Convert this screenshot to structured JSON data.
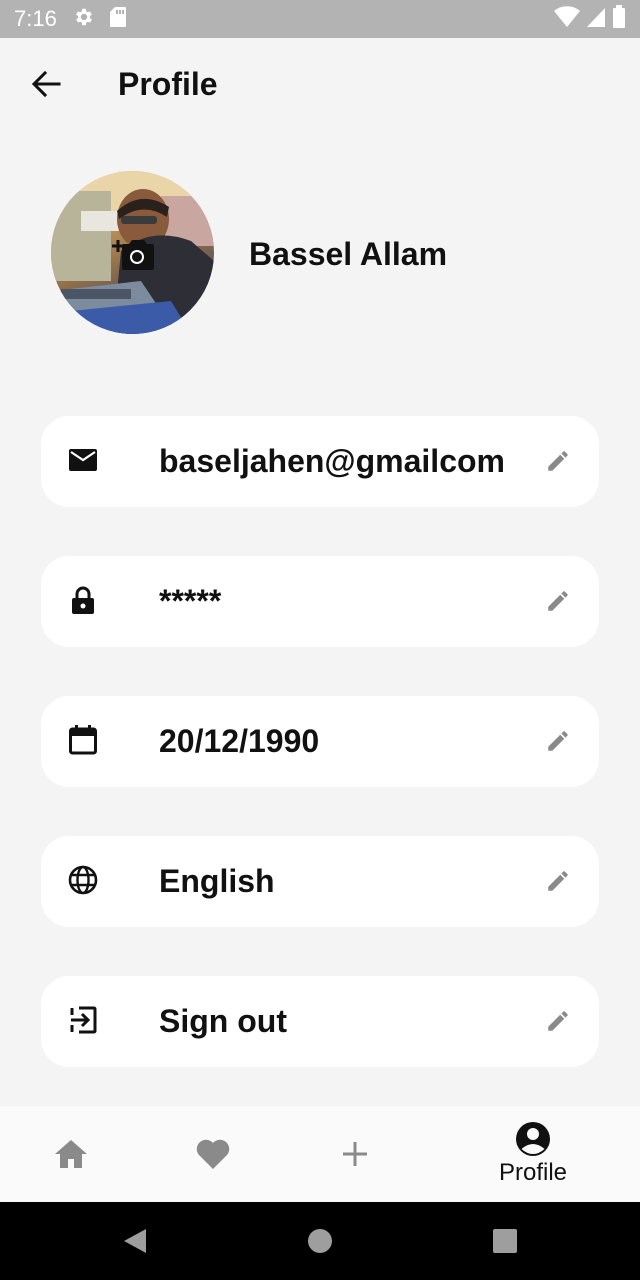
{
  "status_bar": {
    "time": "7:16"
  },
  "app_bar": {
    "title": "Profile"
  },
  "profile": {
    "name": "Bassel Allam"
  },
  "rows": [
    {
      "icon": "email-icon",
      "value": "baseljahen@gmailcom"
    },
    {
      "icon": "lock-icon",
      "value": "*****"
    },
    {
      "icon": "calendar-icon",
      "value": "20/12/1990"
    },
    {
      "icon": "globe-icon",
      "value": "English"
    },
    {
      "icon": "logout-icon",
      "value": "Sign out"
    }
  ],
  "bottom_nav": {
    "items": [
      {
        "icon": "home-icon",
        "label": ""
      },
      {
        "icon": "heart-icon",
        "label": ""
      },
      {
        "icon": "plus-icon",
        "label": ""
      },
      {
        "icon": "account-circle-icon",
        "label": "Profile",
        "active": true
      }
    ]
  },
  "colors": {
    "background": "#f4f4f4",
    "card": "#ffffff",
    "status_bar": "#b3b3b3",
    "inactive_icon": "#8a8a8a",
    "active_icon": "#111111"
  }
}
